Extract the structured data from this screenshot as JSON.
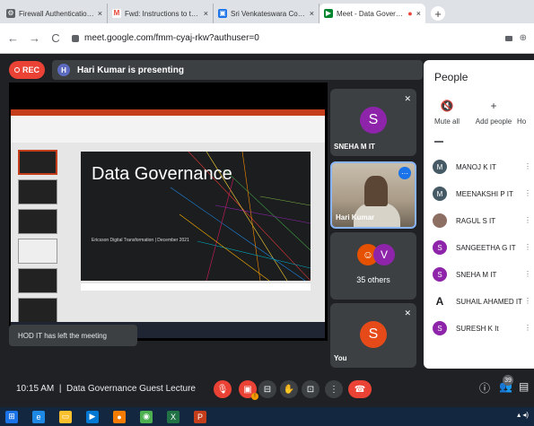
{
  "browser": {
    "tabs": [
      {
        "title": "Firewall Authentication Keepaliv",
        "icon": "firewall-icon",
        "color": "#5f6368"
      },
      {
        "title": "Fwd: Instructions to the Invigilat",
        "icon": "gmail-icon",
        "color": "#ea4335"
      },
      {
        "title": "Sri Venkateswara College of Engi",
        "icon": "college-icon",
        "color": "#1a73e8"
      },
      {
        "title": "Meet - Data Governance Gu",
        "icon": "meet-icon",
        "color": "#00832d"
      }
    ],
    "url": "meet.google.com/fmm-cyaj-rkw?authuser=0"
  },
  "meet": {
    "rec_label": "REC",
    "presenter_initial": "H",
    "presenting_text": "Hari Kumar is presenting",
    "slide": {
      "title": "Data Governance",
      "subtitle": "Ericsson Digital Transformation | December 2021"
    },
    "toast": "HOD IT has left the meeting",
    "tiles": [
      {
        "name": "SNEHA M IT",
        "initial": "S",
        "color": "#8e24aa"
      },
      {
        "name": "Hari Kumar"
      },
      {
        "label": "35 others",
        "initial": "V",
        "color": "#8e24aa"
      },
      {
        "name": "You",
        "initial": "S",
        "color": "#e64a19"
      }
    ]
  },
  "people_panel": {
    "title": "People",
    "actions": [
      "Mute all",
      "Add people",
      "Ho"
    ],
    "participants": [
      {
        "name": "MANOJ K IT",
        "initial": "M",
        "color": "#455a64"
      },
      {
        "name": "MEENAKSHI P IT",
        "initial": "M",
        "color": "#455a64"
      },
      {
        "name": "RAGUL S IT",
        "initial": "",
        "color": "#8d6e63"
      },
      {
        "name": "SANGEETHA G IT",
        "initial": "S",
        "color": "#8e24aa"
      },
      {
        "name": "SNEHA M IT",
        "initial": "S",
        "color": "#8e24aa"
      },
      {
        "name": "SUHAIL AHAMED IT",
        "initial": "A",
        "color": "#ffffff"
      },
      {
        "name": "SURESH K It",
        "initial": "S",
        "color": "#8e24aa"
      }
    ]
  },
  "bottom_bar": {
    "time": "10:15 AM",
    "separator": "|",
    "meeting_name": "Data Governance Guest Lecture",
    "participant_count": "39"
  }
}
